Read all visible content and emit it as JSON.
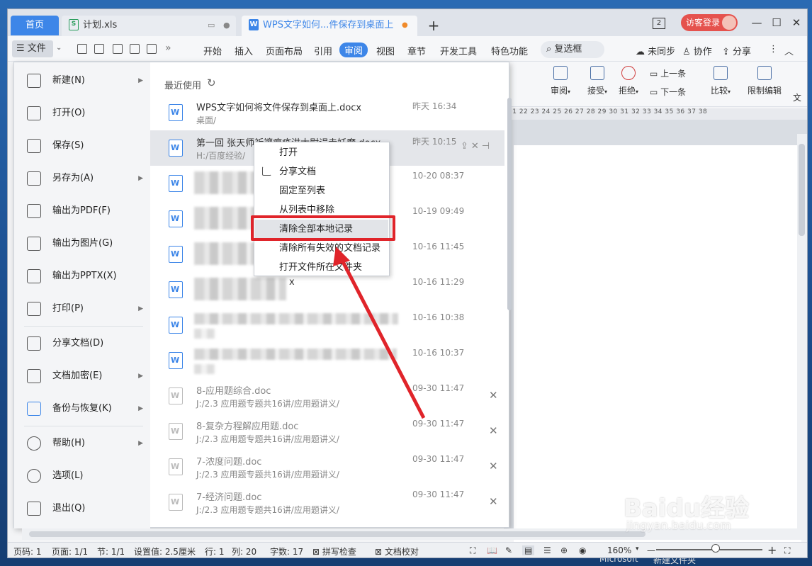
{
  "tabs": {
    "home": "首页",
    "sheet": "计划.xls",
    "doc": "WPS文字如何...件保存到桌面上",
    "new_tab": "+",
    "window_count": "2",
    "login": "访客登录"
  },
  "window_controls": {
    "minimize": "—",
    "maximize": "☐",
    "close": "✕"
  },
  "menubar": {
    "file": "文件",
    "more": "»",
    "tabs": [
      "开始",
      "插入",
      "页面布局",
      "引用",
      "审阅",
      "视图",
      "章节",
      "开发工具",
      "特色功能"
    ],
    "active_tab": "审阅",
    "search": "复选框",
    "sync": "未同步",
    "collab": "协作",
    "share": "分享"
  },
  "ribbon": {
    "review": "审阅",
    "accept": "接受",
    "reject": "拒绝",
    "prev": "上一条",
    "next": "下一条",
    "compare": "比较",
    "restrict": "限制编辑",
    "doc_more": "文"
  },
  "ruler": "21 22 23 24 25 26 27 28 29 30 31 32 33 34 35 36 37 38",
  "file_menu": {
    "items": [
      {
        "label": "新建(N)",
        "arrow": true
      },
      {
        "label": "打开(O)",
        "arrow": false
      },
      {
        "label": "保存(S)",
        "arrow": false
      },
      {
        "label": "另存为(A)",
        "arrow": true
      },
      {
        "label": "输出为PDF(F)",
        "arrow": false
      },
      {
        "label": "输出为图片(G)",
        "arrow": false
      },
      {
        "label": "输出为PPTX(X)",
        "arrow": false
      },
      {
        "label": "打印(P)",
        "arrow": true
      },
      {
        "label": "分享文档(D)",
        "arrow": false
      },
      {
        "label": "文档加密(E)",
        "arrow": true
      },
      {
        "label": "备份与恢复(K)",
        "arrow": true
      },
      {
        "label": "帮助(H)",
        "arrow": true
      },
      {
        "label": "选项(L)",
        "arrow": false
      },
      {
        "label": "退出(Q)",
        "arrow": false
      }
    ],
    "recent_title": "最近使用",
    "recent": [
      {
        "name": "WPS文字如何将文件保存到桌面上.docx",
        "path": "桌面/",
        "time": "昨天 16:34"
      },
      {
        "name": "第一回 张天师祈禳瘟疫洪太尉误走妖魔.docx",
        "path": "H:/百度经验/",
        "time": "昨天 10:15"
      },
      {
        "name": "",
        "path": "",
        "time": "10-20 08:37"
      },
      {
        "name": "",
        "path": "",
        "time": "10-19 09:49"
      },
      {
        "name": "",
        "path": "",
        "time": "10-16 11:45"
      },
      {
        "name": "x",
        "path": "",
        "time": "10-16 11:29"
      },
      {
        "name": "",
        "path": "",
        "time": "10-16 10:38"
      },
      {
        "name": "",
        "path": "",
        "time": "10-16 10:37"
      },
      {
        "name": "8-应用题综合.doc",
        "path": "J:/2.3 应用题专题共16讲/应用题讲义/",
        "time": "09-30 11:47"
      },
      {
        "name": "8-复杂方程解应用题.doc",
        "path": "J:/2.3 应用题专题共16讲/应用题讲义/",
        "time": "09-30 11:47"
      },
      {
        "name": "7-浓度问题.doc",
        "path": "J:/2.3 应用题专题共16讲/应用题讲义/",
        "time": "09-30 11:47"
      },
      {
        "name": "7-经济问题.doc",
        "path": "J:/2.3 应用题专题共16讲/应用题讲义/",
        "time": "09-30 11:47"
      }
    ]
  },
  "context_menu": [
    "打开",
    "分享文档",
    "固定至列表",
    "从列表中移除",
    "清除全部本地记录",
    "清除所有失效的文档记录",
    "打开文件所在文件夹"
  ],
  "status": {
    "page_num": "页码: 1",
    "pages": "页面: 1/1",
    "section": "节: 1/1",
    "setting": "设置值: 2.5厘米",
    "row": "行: 1",
    "col": "列: 20",
    "words": "字数: 17",
    "spell": "拼写检查",
    "proof": "文档校对",
    "zoom": "160%",
    "zoom_minus": "—",
    "zoom_plus": "+"
  },
  "watermark": {
    "main": "Baidu经验",
    "sub": "jingyan.baidu.com"
  },
  "taskbar": {
    "left": "Microsoft",
    "right": "新建文件夹"
  },
  "colors": {
    "accent": "#3d86e8",
    "highlight_box": "#e0242a",
    "login": "#e5524d"
  }
}
